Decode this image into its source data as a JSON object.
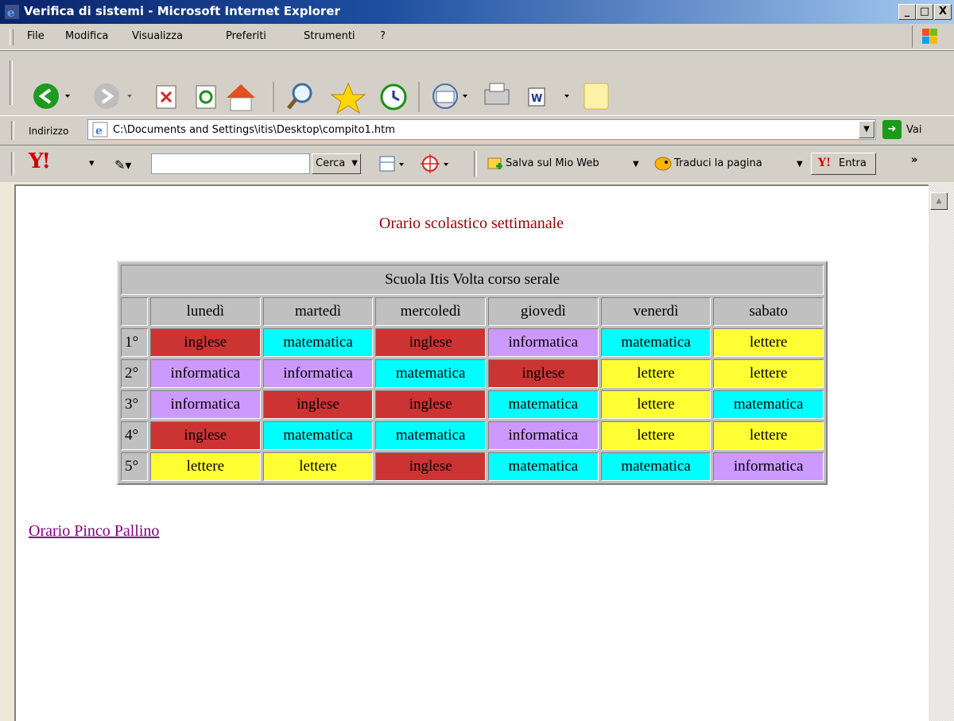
{
  "window": {
    "title": "Verifica di sistemi - Microsoft Internet Explorer",
    "min_label": "_",
    "max_label": "□",
    "close_label": "X"
  },
  "menu": {
    "items": [
      "File",
      "Modifica",
      "Visualizza",
      "Preferiti",
      "Strumenti",
      "?"
    ]
  },
  "address_bar": {
    "label": "Indirizzo",
    "url": "C:\\Documents and Settings\\itis\\Desktop\\compito1.htm",
    "go_label": "Vai"
  },
  "yahoo_bar": {
    "logo": "Y!",
    "search_value": "",
    "search_button": "Cerca",
    "save_label": "Salva sul Mio Web",
    "translate_label": "Traduci la pagina",
    "signin_label": "Entra",
    "more_label": "»"
  },
  "page": {
    "heading": "Orario scolastico settimanale",
    "link_text": "Orario Pinco Pallino",
    "table_caption": "Scuola Itis Volta corso serale",
    "days": [
      "lunedì",
      "martedì",
      "mercoledì",
      "giovedì",
      "venerdì",
      "sabato"
    ],
    "rows": [
      {
        "period": "1°",
        "subjects": [
          "inglese",
          "matematica",
          "inglese",
          "informatica",
          "matematica",
          "lettere"
        ]
      },
      {
        "period": "2°",
        "subjects": [
          "informatica",
          "informatica",
          "matematica",
          "inglese",
          "lettere",
          "lettere"
        ]
      },
      {
        "period": "3°",
        "subjects": [
          "informatica",
          "inglese",
          "inglese",
          "matematica",
          "lettere",
          "matematica"
        ]
      },
      {
        "period": "4°",
        "subjects": [
          "inglese",
          "matematica",
          "matematica",
          "informatica",
          "lettere",
          "lettere"
        ]
      },
      {
        "period": "5°",
        "subjects": [
          "lettere",
          "lettere",
          "inglese",
          "matematica",
          "matematica",
          "informatica"
        ]
      }
    ]
  },
  "colors": {
    "inglese": "#cc3333",
    "matematica": "#00ffff",
    "informatica": "#cc99ff",
    "lettere": "#ffff33",
    "heading": "#990000",
    "link": "#800080"
  }
}
